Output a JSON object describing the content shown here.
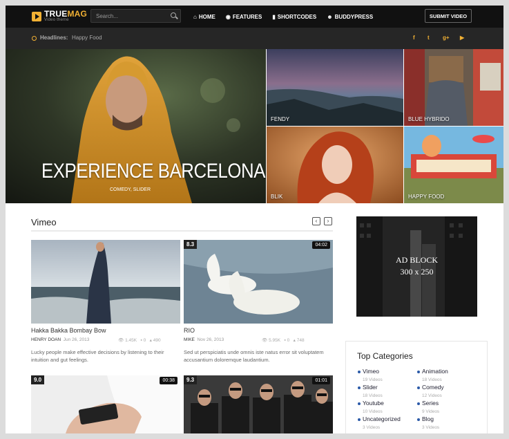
{
  "brand": {
    "name_a": "TRUE",
    "name_b": "MAG",
    "tagline": "Video theme"
  },
  "search": {
    "placeholder": "Search..."
  },
  "nav": [
    {
      "icon": "⌂",
      "label": "HOME"
    },
    {
      "icon": "◉",
      "label": "FEATURES"
    },
    {
      "icon": "▮",
      "label": "SHORTCODES"
    },
    {
      "icon": "☻",
      "label": "BUDDYPRESS"
    }
  ],
  "submit_label": "SUBMIT VIDEO",
  "headlines": {
    "label": "Headlines:",
    "item": "Happy Food"
  },
  "social": [
    "f",
    "t",
    "g+",
    "▶"
  ],
  "hero": {
    "main_title": "EXPERIENCE BARCELONA",
    "main_sub": "COMEDY, SLIDER",
    "tiles": [
      "FENDY",
      "BLUE HYBRIDO",
      "BLIK",
      "HAPPY FOOD"
    ]
  },
  "section": {
    "title": "Vimeo",
    "prev": "‹",
    "next": "›"
  },
  "videos": [
    {
      "title": "Hakka Bakka Bombay Bow",
      "author": "HENRY DOAN",
      "date": "Jun 26, 2013",
      "views": "1.45K",
      "comments": "0",
      "likes": "490",
      "excerpt": "Lucky people make effective decisions by listening to their intuition and gut feelings.",
      "rating": "",
      "duration": ""
    },
    {
      "title": "RIO",
      "author": "MIKE",
      "date": "Nov 26, 2013",
      "views": "5.95K",
      "comments": "0",
      "likes": "748",
      "excerpt": "Sed ut perspiciatis unde omnis iste natus error sit voluptatem accusantium doloremque laudantium.",
      "rating": "8.3",
      "duration": "04:02"
    },
    {
      "rating": "9.0",
      "duration": "00:38"
    },
    {
      "rating": "9.3",
      "duration": "01:01"
    }
  ],
  "ad": {
    "line1": "AD BLOCK",
    "line2": "300 x 250"
  },
  "categories": {
    "title": "Top Categories",
    "items": [
      {
        "name": "Vimeo",
        "count": "19 Videos"
      },
      {
        "name": "Animation",
        "count": "18 Videos"
      },
      {
        "name": "Slider",
        "count": "18 Videos"
      },
      {
        "name": "Comedy",
        "count": "12 Videos"
      },
      {
        "name": "Youtube",
        "count": "10 Videos"
      },
      {
        "name": "Series",
        "count": "9 Videos"
      },
      {
        "name": "Uncategorized",
        "count": "3 Videos"
      },
      {
        "name": "Blog",
        "count": "3 Videos"
      }
    ]
  }
}
